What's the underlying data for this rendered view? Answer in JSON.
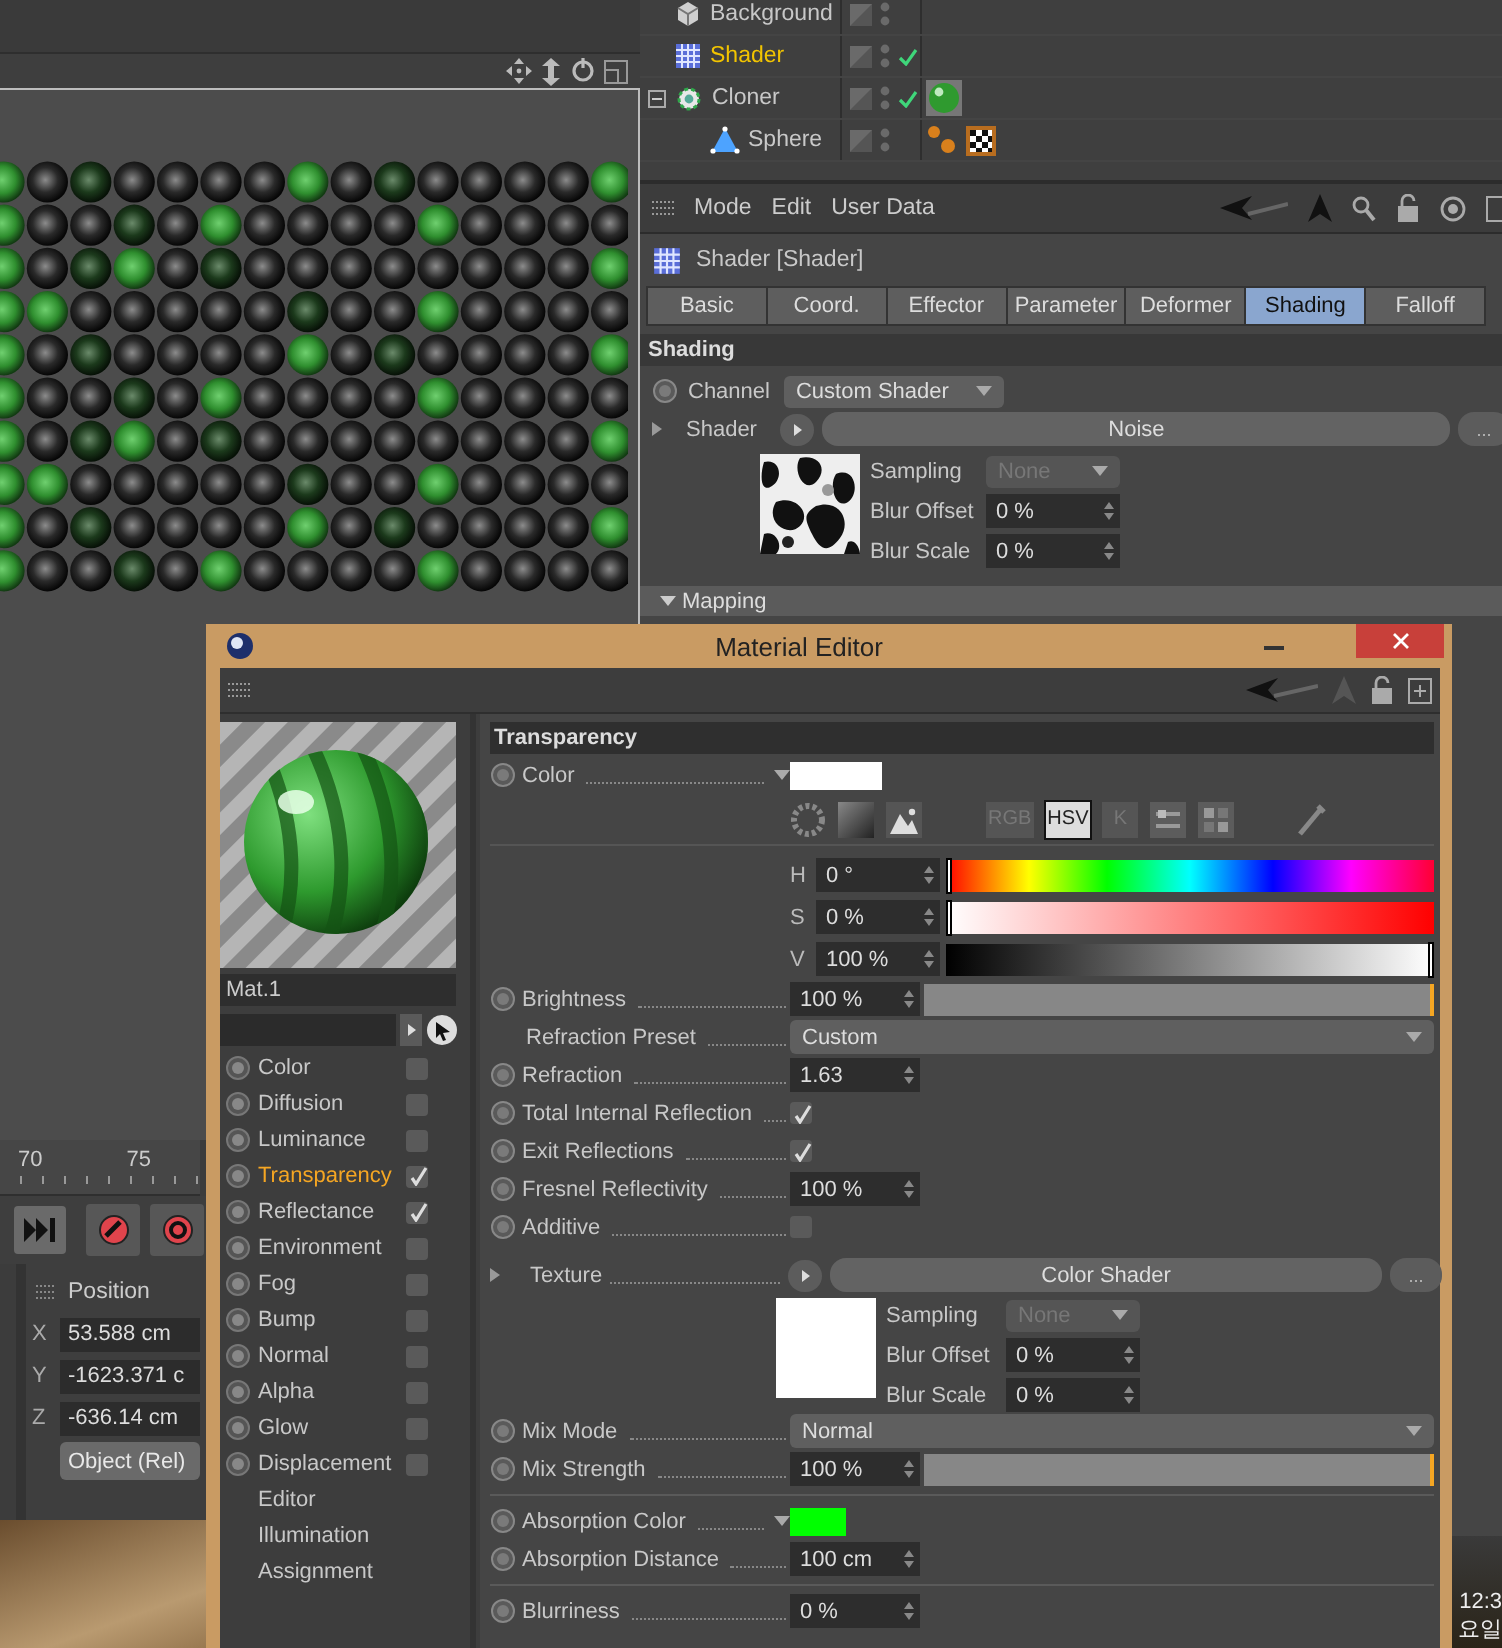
{
  "object_manager": {
    "objects": [
      {
        "name": "Background",
        "kind": "background",
        "selected": false,
        "enabled": false
      },
      {
        "name": "Shader",
        "kind": "shader",
        "selected": true,
        "enabled": true
      },
      {
        "name": "Cloner",
        "kind": "cloner",
        "selected": false,
        "enabled": true,
        "expanded": true,
        "tags": [
          {
            "kind": "material"
          }
        ],
        "children": [
          {
            "name": "Sphere",
            "kind": "sphere",
            "selected": false,
            "enabled": false,
            "tags": [
              {
                "kind": "phong"
              },
              {
                "kind": "checker"
              }
            ]
          }
        ]
      }
    ]
  },
  "attribute_manager": {
    "menu": [
      "Mode",
      "Edit",
      "User Data"
    ],
    "title": "Shader [Shader]",
    "tabs": [
      {
        "label": "Basic",
        "selected": false
      },
      {
        "label": "Coord.",
        "selected": false
      },
      {
        "label": "Effector",
        "selected": false
      },
      {
        "label": "Parameter",
        "selected": false
      },
      {
        "label": "Deformer",
        "selected": false
      },
      {
        "label": "Shading",
        "selected": true
      },
      {
        "label": "Falloff",
        "selected": false
      }
    ],
    "section": "Shading",
    "channel": {
      "label": "Channel",
      "value": "Custom Shader"
    },
    "shader": {
      "label": "Shader",
      "value": "Noise",
      "more": "...",
      "sampling": {
        "label": "Sampling",
        "value": "None",
        "disabled": true
      },
      "fields": [
        {
          "label": "Blur Offset",
          "value": "0 %"
        },
        {
          "label": "Blur Scale",
          "value": "0 %"
        }
      ]
    },
    "subsection": "Mapping"
  },
  "timeline": {
    "ticks": [
      "70",
      "75"
    ]
  },
  "coordinates": {
    "title": "Position",
    "fields": [
      {
        "axis": "X",
        "value": "53.588 cm"
      },
      {
        "axis": "Y",
        "value": "-1623.371 c"
      },
      {
        "axis": "Z",
        "value": "-636.14 cm"
      }
    ],
    "mode": "Object (Rel)"
  },
  "taskbar": {
    "time": "12:3",
    "date": "요일"
  },
  "material_editor": {
    "title": "Material Editor",
    "material_name": "Mat.1",
    "channels": [
      {
        "label": "Color",
        "selected": false,
        "checked": false
      },
      {
        "label": "Diffusion",
        "selected": false,
        "checked": false
      },
      {
        "label": "Luminance",
        "selected": false,
        "checked": false
      },
      {
        "label": "Transparency",
        "selected": true,
        "checked": true
      },
      {
        "label": "Reflectance",
        "selected": false,
        "checked": true
      },
      {
        "label": "Environment",
        "selected": false,
        "checked": false
      },
      {
        "label": "Fog",
        "selected": false,
        "checked": false
      },
      {
        "label": "Bump",
        "selected": false,
        "checked": false
      },
      {
        "label": "Normal",
        "selected": false,
        "checked": false
      },
      {
        "label": "Alpha",
        "selected": false,
        "checked": false
      },
      {
        "label": "Glow",
        "selected": false,
        "checked": false
      },
      {
        "label": "Displacement",
        "selected": false,
        "checked": false
      }
    ],
    "pages": [
      {
        "label": "Editor",
        "selected": false
      },
      {
        "label": "Illumination",
        "selected": false
      },
      {
        "label": "Assignment",
        "selected": false
      }
    ],
    "panel": {
      "title": "Transparency",
      "groups": [
        {
          "rows": [
            {
              "kind": "color",
              "label": "Color",
              "animatable": true,
              "color": "#ffffff",
              "modes": [
                {
                  "label": "RGB",
                  "selected": false
                },
                {
                  "label": "HSV",
                  "selected": true
                },
                {
                  "label": "K",
                  "selected": false
                }
              ],
              "hsv": [
                {
                  "label": "H",
                  "value": "0 °",
                  "level": 0
                },
                {
                  "label": "S",
                  "value": "0 %",
                  "level": 0
                },
                {
                  "label": "V",
                  "value": "100 %",
                  "level": 1
                }
              ]
            },
            {
              "kind": "slider",
              "label": "Brightness",
              "animatable": true,
              "value": "100 %",
              "level": 1
            },
            {
              "kind": "dropdown",
              "label": "Refraction Preset",
              "animatable": false,
              "value": "Custom"
            },
            {
              "kind": "number",
              "label": "Refraction",
              "animatable": true,
              "value": "1.63"
            },
            {
              "kind": "checkbox",
              "label": "Total Internal Reflection",
              "animatable": true,
              "checked": true
            },
            {
              "kind": "checkbox",
              "label": "Exit Reflections",
              "animatable": true,
              "checked": true
            },
            {
              "kind": "number",
              "label": "Fresnel Reflectivity",
              "animatable": true,
              "value": "100 %"
            },
            {
              "kind": "checkbox",
              "label": "Additive",
              "animatable": true,
              "checked": false
            },
            {
              "kind": "texture",
              "label": "Texture",
              "value": "Color Shader",
              "more": "...",
              "sampling": {
                "label": "Sampling",
                "value": "None",
                "disabled": true
              },
              "fields": [
                {
                  "label": "Blur Offset",
                  "value": "0 %"
                },
                {
                  "label": "Blur Scale",
                  "value": "0 %"
                }
              ]
            },
            {
              "kind": "dropdown",
              "label": "Mix Mode",
              "animatable": true,
              "value": "Normal"
            },
            {
              "kind": "slider",
              "label": "Mix Strength",
              "animatable": true,
              "value": "100 %",
              "level": 1
            }
          ]
        },
        {
          "rows": [
            {
              "kind": "swatch",
              "label": "Absorption Color",
              "animatable": true,
              "color": "#00ff00"
            },
            {
              "kind": "number",
              "label": "Absorption Distance",
              "animatable": true,
              "value": "100 cm"
            }
          ]
        },
        {
          "rows": [
            {
              "kind": "number",
              "label": "Blurriness",
              "animatable": true,
              "value": "0 %"
            }
          ]
        }
      ]
    }
  }
}
